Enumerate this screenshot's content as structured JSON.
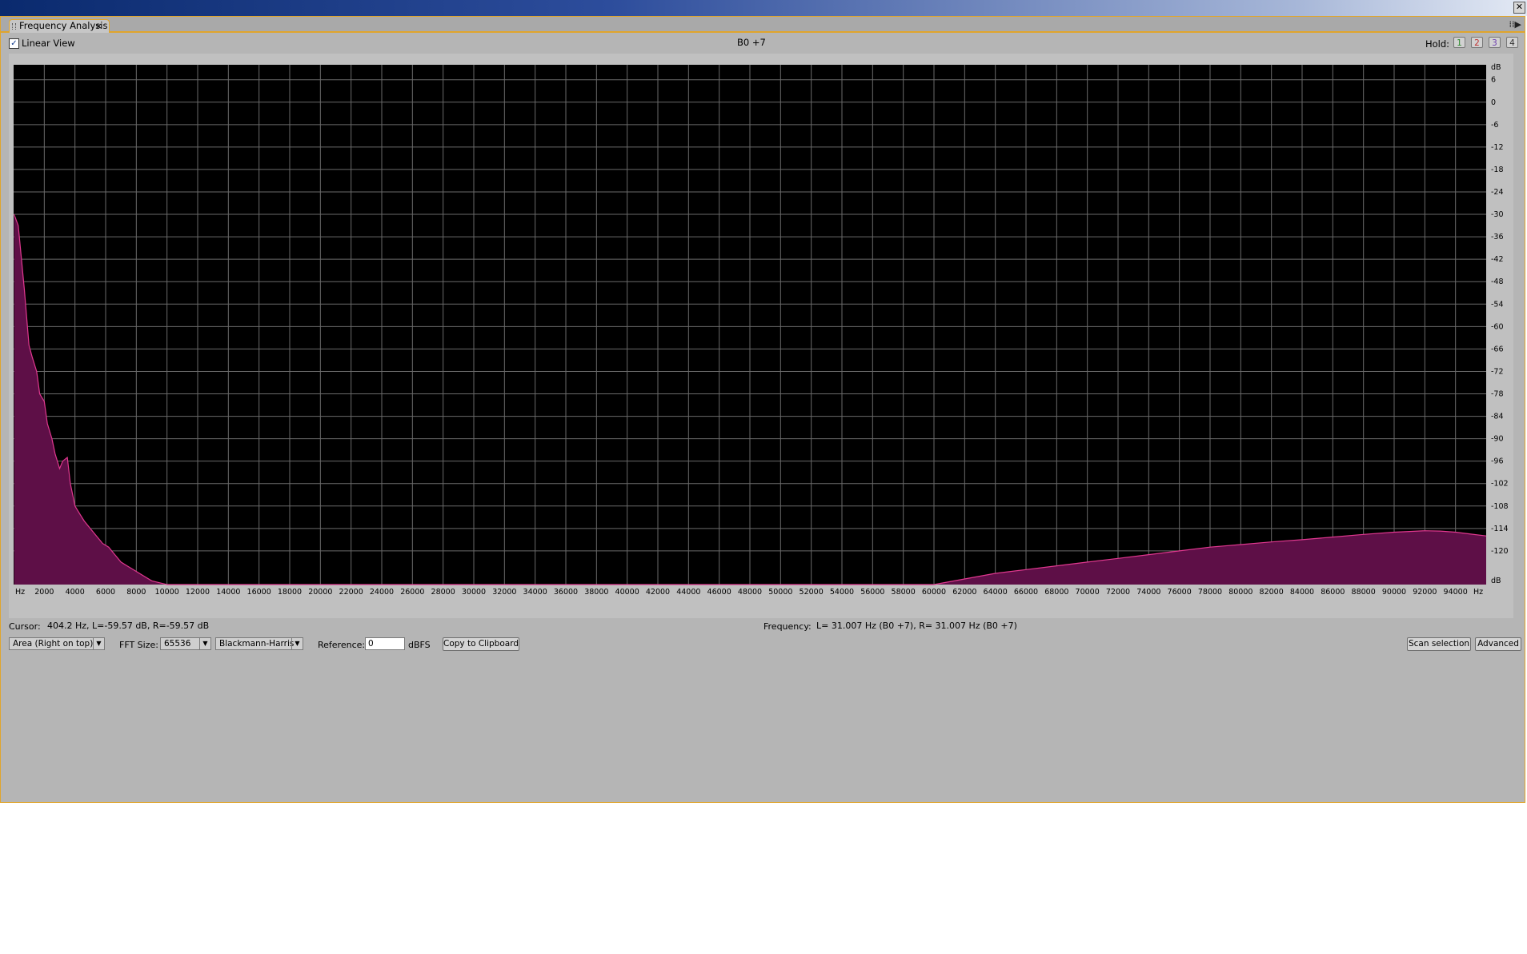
{
  "window": {
    "close_glyph": "✕"
  },
  "panel": {
    "tab_label": "Frequency Analysis",
    "tab_close_glyph": "×",
    "menu_glyph": "⁞⁞▶"
  },
  "toolbar": {
    "linear_view_label": "Linear View",
    "linear_view_checked": true,
    "note_title": "B0 +7",
    "hold_label": "Hold:",
    "hold_buttons": [
      {
        "label": "1",
        "color": "#2e8b2e"
      },
      {
        "label": "2",
        "color": "#c03030"
      },
      {
        "label": "3",
        "color": "#7040b0"
      },
      {
        "label": "4",
        "color": "#303030"
      }
    ]
  },
  "chart_data": {
    "type": "area",
    "x_unit": "Hz",
    "y_unit": "dB",
    "xlim": [
      0,
      96000
    ],
    "ylim": [
      -129,
      10
    ],
    "x_ticks": [
      2000,
      4000,
      6000,
      8000,
      10000,
      12000,
      14000,
      16000,
      18000,
      20000,
      22000,
      24000,
      26000,
      28000,
      30000,
      32000,
      34000,
      36000,
      38000,
      40000,
      42000,
      44000,
      46000,
      48000,
      50000,
      52000,
      54000,
      56000,
      58000,
      60000,
      62000,
      64000,
      66000,
      68000,
      70000,
      72000,
      74000,
      76000,
      78000,
      80000,
      82000,
      84000,
      86000,
      88000,
      90000,
      92000,
      94000
    ],
    "y_ticks": [
      6,
      0,
      -6,
      -12,
      -18,
      -24,
      -30,
      -36,
      -42,
      -48,
      -54,
      -60,
      -66,
      -72,
      -78,
      -84,
      -90,
      -96,
      -102,
      -108,
      -114,
      -120
    ],
    "grid": true,
    "fill_color": "#5e0f47",
    "line_color": "#e0388f",
    "background": "#000000",
    "series": [
      {
        "x": [
          31,
          300,
          700,
          1000,
          1200,
          1500,
          1700,
          2000,
          2200,
          2500,
          2700,
          3000,
          3200,
          3500,
          3700,
          4000,
          4300,
          4600,
          5000,
          5400,
          5800,
          6200,
          6600,
          7000,
          7400,
          7800,
          8200,
          8600,
          9000,
          9500,
          10000,
          60000,
          62000,
          64000,
          66000,
          68000,
          70000,
          72000,
          74000,
          76000,
          78000,
          80000,
          82000,
          84000,
          86000,
          88000,
          90000,
          91000,
          92000,
          93000,
          94000,
          95000,
          96000
        ],
        "y": [
          -30,
          -33,
          -50,
          -65,
          -68,
          -72,
          -78,
          -80,
          -86,
          -90,
          -94,
          -98,
          -96,
          -95,
          -102,
          -108,
          -110,
          -112,
          -114,
          -116,
          -118,
          -119,
          -121,
          -123,
          -124,
          -125,
          -126,
          -127,
          -128,
          -128.5,
          -129,
          -129,
          -127.5,
          -126,
          -125,
          -124,
          -123,
          -122,
          -121,
          -120,
          -119,
          -118.3,
          -117.6,
          -117,
          -116.3,
          -115.6,
          -115,
          -114.8,
          -114.6,
          -114.7,
          -115,
          -115.5,
          -116
        ]
      }
    ]
  },
  "status": {
    "cursor_label": "Cursor:",
    "cursor_value": "404.2 Hz, L=-59.57 dB, R=-59.57 dB",
    "frequency_label": "Frequency:",
    "frequency_value": "L= 31.007 Hz (B0 +7), R= 31.007 Hz (B0 +7)"
  },
  "controls": {
    "display_mode": "Area (Right on top)",
    "fft_size_label": "FFT Size:",
    "fft_size": "65536",
    "window_function": "Blackmann-Harris",
    "reference_label": "Reference:",
    "reference_value": "0",
    "reference_unit": "dBFS",
    "copy_button": "Copy to Clipboard",
    "scan_button": "Scan selection",
    "advanced_button": "Advanced",
    "dropdown_glyph": "▼"
  }
}
